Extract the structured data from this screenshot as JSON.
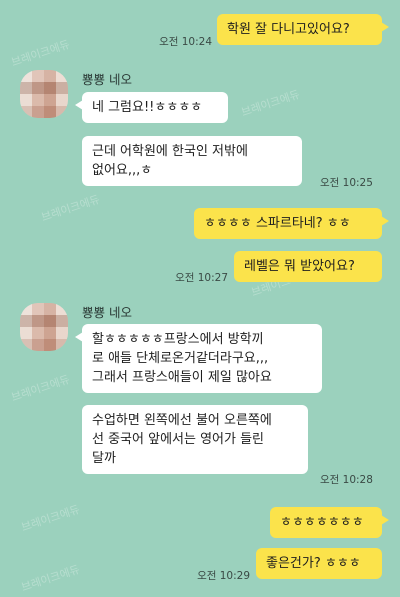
{
  "watermark": "브레이크에듀",
  "colors": {
    "background": "#9bd1bd",
    "my_bubble": "#fbe34b",
    "other_bubble": "#ffffff"
  },
  "messages": [
    {
      "id": "m1",
      "from": "me",
      "text": "학원 잘 다니고있어요?",
      "time": "오전 10:24"
    },
    {
      "id": "m2",
      "from": "other",
      "sender": "뿅뿅 네오",
      "text": "네 그럼요!!ㅎㅎㅎㅎ"
    },
    {
      "id": "m3",
      "from": "other",
      "text": "근데 어학원에 한국인 저밖에 없어요,,,ㅎ",
      "time": "오전 10:25"
    },
    {
      "id": "m4",
      "from": "me",
      "text": "ㅎㅎㅎㅎ 스파르타네? ㅎㅎ"
    },
    {
      "id": "m5",
      "from": "me",
      "text": "레벨은 뭐 받았어요?",
      "time": "오전 10:27"
    },
    {
      "id": "m6",
      "from": "other",
      "sender": "뿅뿅 네오",
      "text": "할ㅎㅎㅎㅎㅎ프랑스에서 방학끼\n로 애들 단체로온거같더라구요,,,\n그래서 프랑스애들이 제일 많아요"
    },
    {
      "id": "m7",
      "from": "other",
      "text": "수업하면 왼쪽에선 불어 오른쪽에\n선 중국어 앞에서는 영어가 들린\n달까",
      "time": "오전 10:28"
    },
    {
      "id": "m8",
      "from": "me",
      "text": "ㅎㅎㅎㅎㅎㅎㅎ"
    },
    {
      "id": "m9",
      "from": "me",
      "text": "좋은건가? ㅎㅎㅎ",
      "time": "오전 10:29"
    }
  ]
}
